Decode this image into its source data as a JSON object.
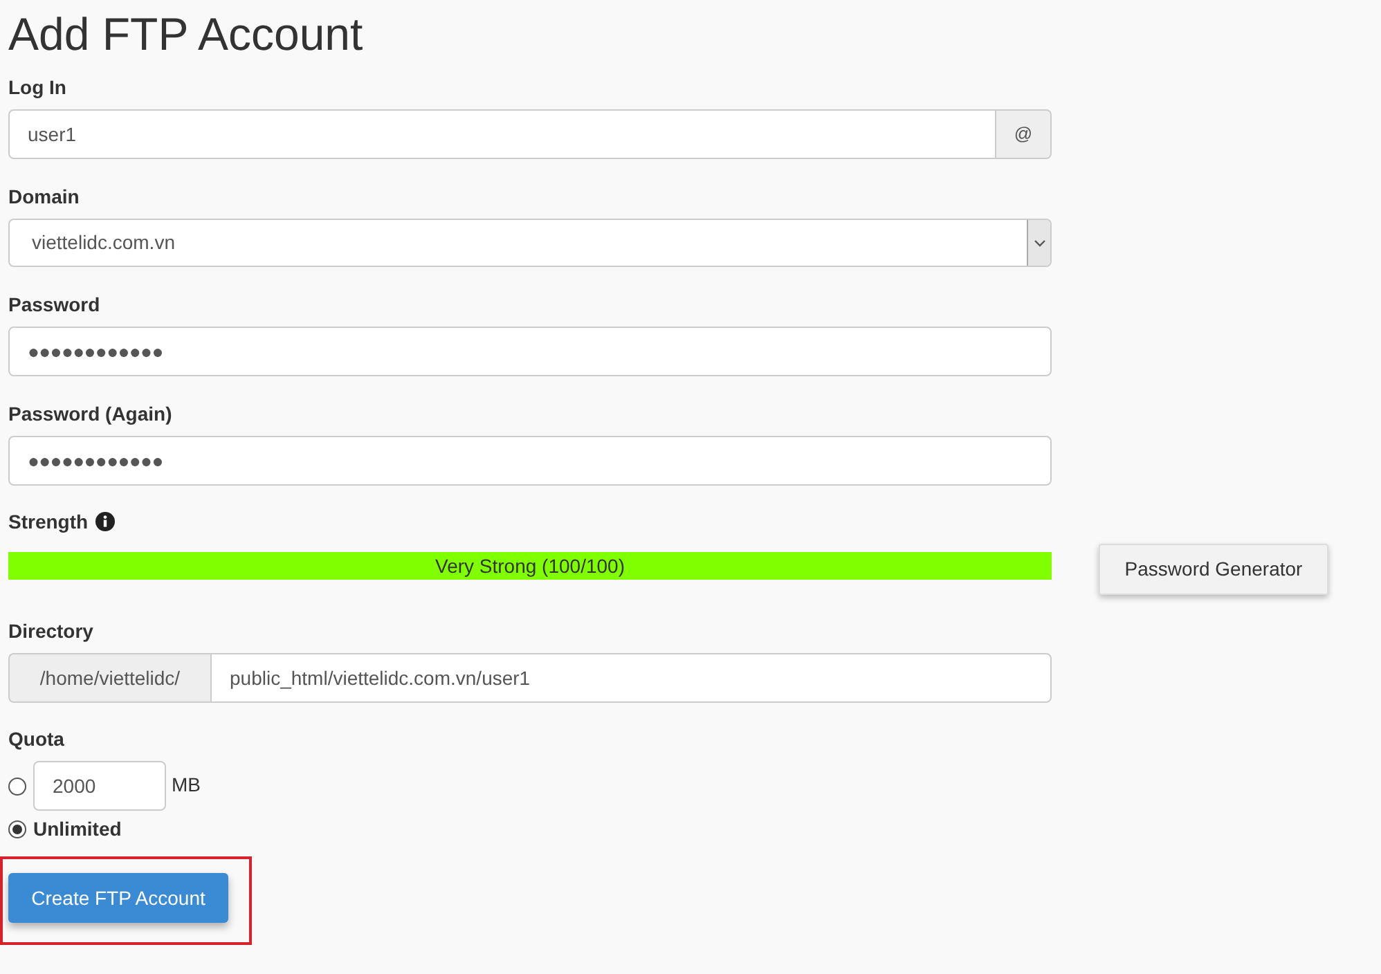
{
  "title": "Add FTP Account",
  "fields": [
    {
      "kind": "addon_right",
      "label": "Log In",
      "value": "user1",
      "addon": "@"
    },
    {
      "kind": "select",
      "label": "Domain",
      "value": "viettelidc.com.vn"
    },
    {
      "kind": "text",
      "label": "Password",
      "value": "●●●●●●●●●●●●"
    },
    {
      "kind": "text",
      "label": "Password (Again)",
      "value": "●●●●●●●●●●●●"
    },
    {
      "kind": "meter",
      "label": "Strength",
      "level": 1,
      "reading": "Very Strong (100/100)",
      "button": "Password Generator"
    },
    {
      "kind": "addon_left",
      "label": "Directory",
      "addon": "/home/viettelidc/",
      "value": "public_html/viettelidc.com.vn/user1"
    },
    {
      "kind": "quota",
      "label": "Quota",
      "options": [
        {
          "kind": "amount",
          "value": "2000",
          "unit": "MB",
          "selected": false
        },
        {
          "kind": "plain",
          "label": "Unlimited",
          "selected": true
        }
      ]
    }
  ],
  "submit": {
    "label": "Create FTP Account",
    "highlighted": true
  }
}
